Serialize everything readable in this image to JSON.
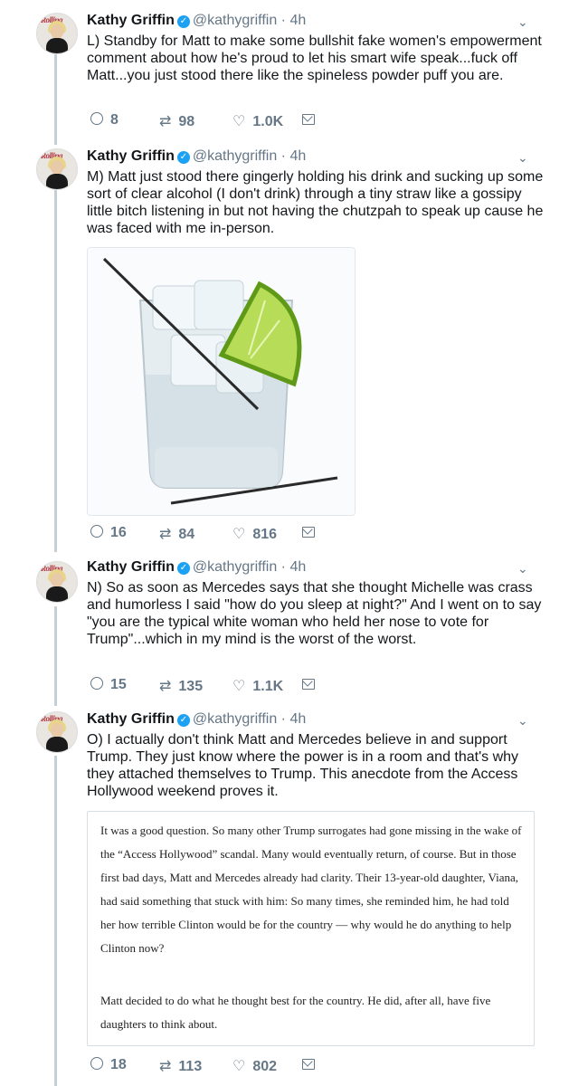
{
  "tweets": [
    {
      "name": "Kathy Griffin",
      "handle": "@kathygriffin",
      "time": "· 4h",
      "text": "L) Standby for Matt to make some bullshit fake women's empowerment comment about how he's proud to let his smart wife speak...fuck off Matt...you just stood there like the spineless powder puff you are.",
      "replies": "8",
      "retweets": "98",
      "likes": "1.0K"
    },
    {
      "name": "Kathy Griffin",
      "handle": "@kathygriffin",
      "time": "· 4h",
      "text": "M) Matt just stood there gingerly holding his drink and sucking up some sort of clear alcohol (I don't drink) through a tiny straw like a gossipy little bitch listening in but not having the chutzpah to speak up cause he was faced with me in-person.",
      "replies": "16",
      "retweets": "84",
      "likes": "816"
    },
    {
      "name": "Kathy Griffin",
      "handle": "@kathygriffin",
      "time": "· 4h",
      "text": "N) So as soon as Mercedes says that she thought Michelle was crass and humorless I said \"how do you sleep at night?\" And I went on to say \"you are the typical white woman who held her nose to vote for Trump\"...which in my mind is the worst of the worst.",
      "replies": "15",
      "retweets": "135",
      "likes": "1.1K"
    },
    {
      "name": "Kathy Griffin",
      "handle": "@kathygriffin",
      "time": "· 4h",
      "text": "O) I actually don't think Matt and Mercedes believe in and support Trump. They just know where the power is in a room and that's why they attached themselves to Trump. This anecdote from the Access Hollywood weekend proves it.",
      "replies": "18",
      "retweets": "113",
      "likes": "802"
    }
  ],
  "avatar_masthead": "Rolling",
  "quote": {
    "p1": "It was a good question. So many other Trump surrogates had gone missing in the wake of the “Access Hollywood” scandal. Many would eventually return, of course. But in those first bad days, Matt and Mercedes already had clarity. Their 13-year-old daughter, Viana, had said something that stuck with him: So many times, she reminded him, he had told her how terrible Clinton would be for the country — why would he do anything to help Clinton now?",
    "p2": "Matt decided to do what he thought best for the country. He did, after all, have five daughters to think about."
  },
  "icons": {
    "verified": "verified-badge-icon",
    "chevron": "chevron-down-icon",
    "reply": "reply-icon",
    "retweet": "retweet-icon",
    "like": "heart-icon",
    "dm": "envelope-icon"
  },
  "colors": {
    "verified": "#1da1f2",
    "meta": "#657786",
    "thread_line": "#c4cfd6"
  }
}
